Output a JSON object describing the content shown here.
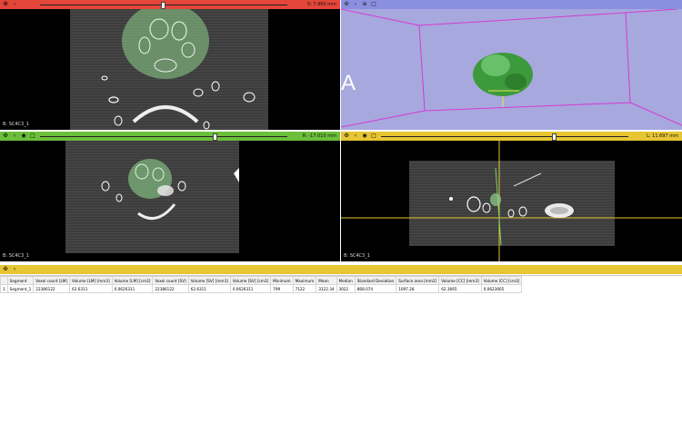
{
  "views": {
    "red": {
      "color": "#e4463a",
      "slider_value": "S: 7.960 mm",
      "label": "B: SC4C3_1",
      "slider_fraction": 0.44
    },
    "threed": {
      "color": "#8a8fe0",
      "bg": "#a7a8dd",
      "glyph": "A"
    },
    "green": {
      "color": "#6bbf3a",
      "slider_value": "R: -17.010 mm",
      "label": "B: SC4C3_1",
      "slider_fraction": 0.62
    },
    "yellow": {
      "color": "#e6c632",
      "slider_value": "L: 11.697 mm",
      "label": "B: SC4C3_1",
      "slider_fraction": 0.65
    }
  },
  "toolbar_icons": [
    "pin-icon",
    "link-icon",
    "eye-icon",
    "layout-icon"
  ],
  "table": {
    "headers": [
      "",
      "Segment",
      "Voxel count [LM]",
      "Volume [LM] [mm3]",
      "Volume [LM] [cm3]",
      "Voxel count [SV]",
      "Volume [SV] [mm3]",
      "Volume [SV] [cm3]",
      "Minimum",
      "Maximum",
      "Mean",
      "Median",
      "Standard Deviation",
      "Surface area [mm2]",
      "Volume [CC] [mm3]",
      "Volume [CC] [cm3]"
    ],
    "rows": [
      [
        "1",
        "Segment_1",
        "22386122",
        "62.6311",
        "0.0626311",
        "22386122",
        "62.6311",
        "0.0626311",
        "799",
        "7122",
        "3122.34",
        "3022",
        "868.074",
        "1097.28",
        "62.3665",
        "0.0623665"
      ]
    ]
  }
}
